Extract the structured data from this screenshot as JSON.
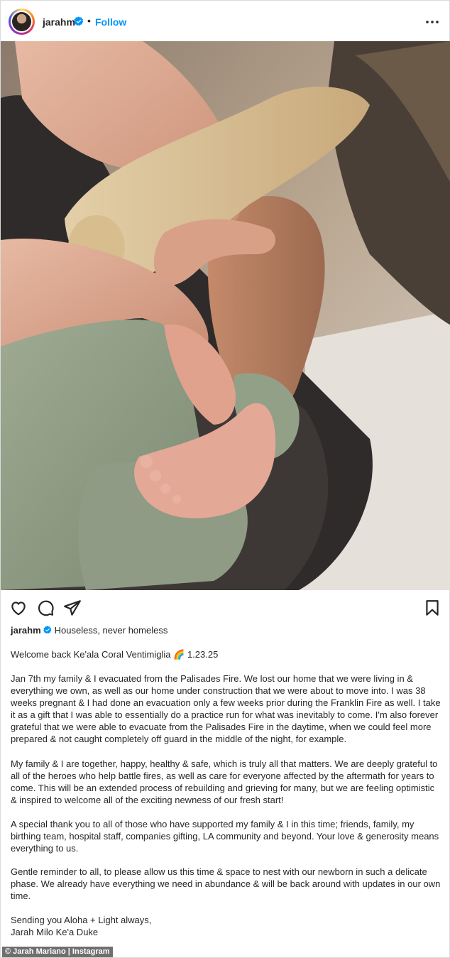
{
  "header": {
    "username": "jarahm",
    "separator": "•",
    "follow_label": "Follow"
  },
  "post": {
    "image_icon": "photo-newborn-dog-paw"
  },
  "actions": {
    "like_icon": "heart-icon",
    "comment_icon": "comment-icon",
    "share_icon": "share-icon",
    "save_icon": "bookmark-icon"
  },
  "caption": {
    "username": "jarahm",
    "headline": "Houseless, never homeless",
    "welcome_text": "Welcome back Ke'ala Coral Ventimiglia",
    "welcome_emoji": "🌈",
    "welcome_date": "1.23.25",
    "paragraph_1": "Jan 7th my family & I evacuated from the Palisades Fire. We lost our home that we were living in & everything we own, as well as our home under construction that we were about to move into. I was 38 weeks pregnant & I had done an evacuation only a few weeks prior during the Franklin Fire as well. I take it as a gift that I was able to essentially do a practice run for what was inevitably to come. I'm also forever grateful that we were able to evacuate from the Palisades Fire in the daytime, when we could feel more prepared & not caught completely off guard in the middle of the night, for example.",
    "paragraph_2": "My family & I are together, happy, healthy & safe, which is truly all that matters. We are deeply grateful to all of the heroes who help battle fires, as well as care for everyone affected by the aftermath for years to come. This will be an extended process of rebuilding and grieving for many, but we are feeling optimistic & inspired to welcome all of the exciting newness of our fresh start!",
    "paragraph_3": "A special thank you to all of those who have supported my family & I in this time; friends, family, my birthing team, hospital staff, companies gifting, LA community and beyond. Your love & generosity means everything to us.",
    "paragraph_4": "Gentle reminder to all, to please allow us this time & space to nest with our newborn in such a delicate phase. We already have everything we need in abundance & will be back around with updates in our own time.",
    "signoff_1": "Sending you Aloha + Light always,",
    "signoff_2": "Jarah Milo Ke'a Duke"
  },
  "credit": "© Jarah Mariano | Instagram",
  "colors": {
    "link_blue": "#0095f6",
    "verified_blue": "#0095f6",
    "text": "#262626"
  }
}
